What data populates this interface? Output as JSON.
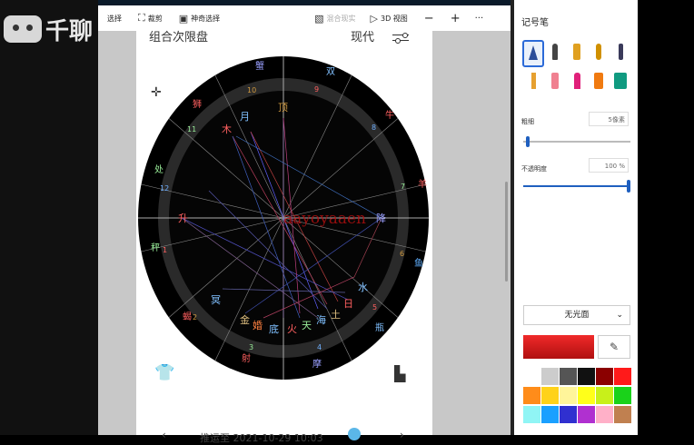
{
  "watermark": {
    "text": "千聊"
  },
  "toolbar": {
    "select": "选择",
    "crop": "裁剪",
    "magic_select": "神奇选择",
    "mixed_reality": "混合现实",
    "view_3d": "3D 视图",
    "minus": "−",
    "plus": "+",
    "more": "···"
  },
  "phone": {
    "title": "组合次限盘",
    "mode": "现代",
    "bottom_text": "推运至 2021-10-29 10:03"
  },
  "chart_ring": {
    "signs": [
      "蟹",
      "双",
      "牛",
      "羊",
      "鱼",
      "瓶",
      "摩",
      "射",
      "蝎",
      "秤",
      "处",
      "狮"
    ],
    "houses": [
      "10",
      "9",
      "8",
      "7",
      "6",
      "5",
      "4",
      "3",
      "2",
      "1",
      "12",
      "11"
    ]
  },
  "planets": {
    "moon": "月",
    "jupiter": "木",
    "mc": "顶",
    "asc": "升",
    "dsc": "降",
    "neptune": "冥",
    "venus": "金",
    "marriage": "婚",
    "ic": "底",
    "mars": "火",
    "heaven": "天",
    "sea": "海",
    "earth": "土",
    "sun": "日",
    "water": "水"
  },
  "overlay_text": "aayoyaaen",
  "pen_panel": {
    "title": "记号笔",
    "thickness_label": "粗细",
    "thickness_value": "5像素",
    "opacity_label": "不透明度",
    "opacity_value": "100 %",
    "finish": "无光面",
    "current_color": "#e02020",
    "palette": [
      "#ffffff",
      "#cccccc",
      "#555555",
      "#111111",
      "#8b0000",
      "#ff1a1a",
      "#ff8c1a",
      "#ffd21a",
      "#fff59a",
      "#ffff1a",
      "#c8f01a",
      "#1ad21a",
      "#90f5f5",
      "#1aa0ff",
      "#3030d0",
      "#b030d0",
      "#ffb0c8",
      "#c08050"
    ]
  }
}
